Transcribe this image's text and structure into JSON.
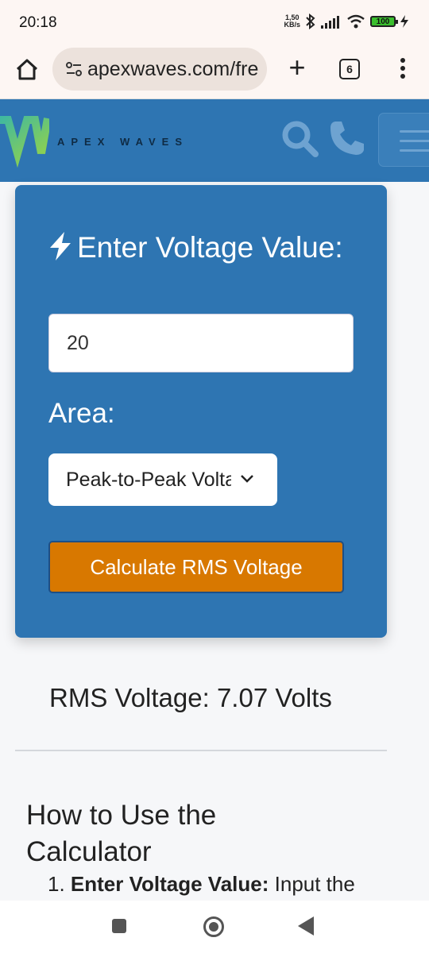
{
  "status_bar": {
    "time": "20:18",
    "net_speed_value": "1,50",
    "net_speed_unit": "KB/s",
    "battery": "100"
  },
  "browser": {
    "url": "apexwaves.com/fre",
    "tab_count": "6"
  },
  "site": {
    "logo_text": "APEX WAVES",
    "brand_color": "#2e75b2"
  },
  "calculator": {
    "title": "Enter Voltage Value:",
    "voltage_value": "20",
    "area_label": "Area:",
    "area_selected": "Peak-to-Peak Voltage",
    "button_label": "Calculate RMS Voltage",
    "button_color": "#d87800"
  },
  "result": {
    "text": "RMS Voltage: 7.07 Volts"
  },
  "howto": {
    "heading": "How to Use the Calculator",
    "step1_number": "1.",
    "step1_bold": "Enter Voltage Value:",
    "step1_text": " Input the"
  },
  "icons": [
    "home-icon",
    "site-info-icon",
    "plus-icon",
    "tabs-icon",
    "more-vert-icon",
    "search-icon",
    "phone-icon",
    "hamburger-icon",
    "bolt-icon",
    "chevron-down-icon"
  ]
}
